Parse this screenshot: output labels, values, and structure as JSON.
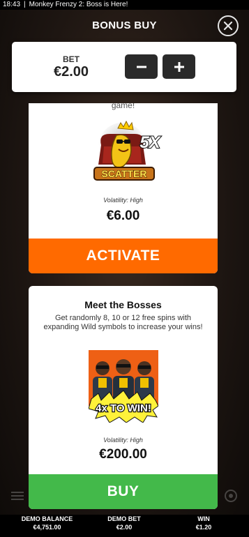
{
  "statusbar": {
    "time": "18:43",
    "separator": "|",
    "window_title": "Monkey Frenzy 2: Boss is Here!"
  },
  "header": {
    "title": "BONUS BUY",
    "close_icon": "close-icon"
  },
  "bet": {
    "label": "BET",
    "value": "€2.00",
    "minus_icon": "minus-icon",
    "plus_icon": "plus-icon"
  },
  "cards": [
    {
      "fade_text": "game!",
      "art": {
        "badge": "5X",
        "logo_text": "SCATTER",
        "icon": "banana-king-icon"
      },
      "volatility": "Volatility: High",
      "price": "€6.00",
      "action_label": "ACTIVATE"
    },
    {
      "title": "Meet the Bosses",
      "description": "Get randomly 8, 10 or 12 free spins with expanding Wild symbols to increase your wins!",
      "art": {
        "banner": "4x TO WIN!",
        "icon": "boss-monkeys-icon"
      },
      "volatility": "Volatility: High",
      "price": "€200.00",
      "action_label": "BUY"
    }
  ],
  "footer": {
    "balance_label": "DEMO BALANCE",
    "balance_value": "€4,751.00",
    "bet_label": "DEMO BET",
    "bet_value": "€2.00",
    "win_label": "WIN",
    "win_value": "€1.20"
  },
  "colors": {
    "activate": "#ff6a00",
    "buy": "#43b94a",
    "stepper": "#2a2a2a",
    "footer_bg": "#000000"
  }
}
